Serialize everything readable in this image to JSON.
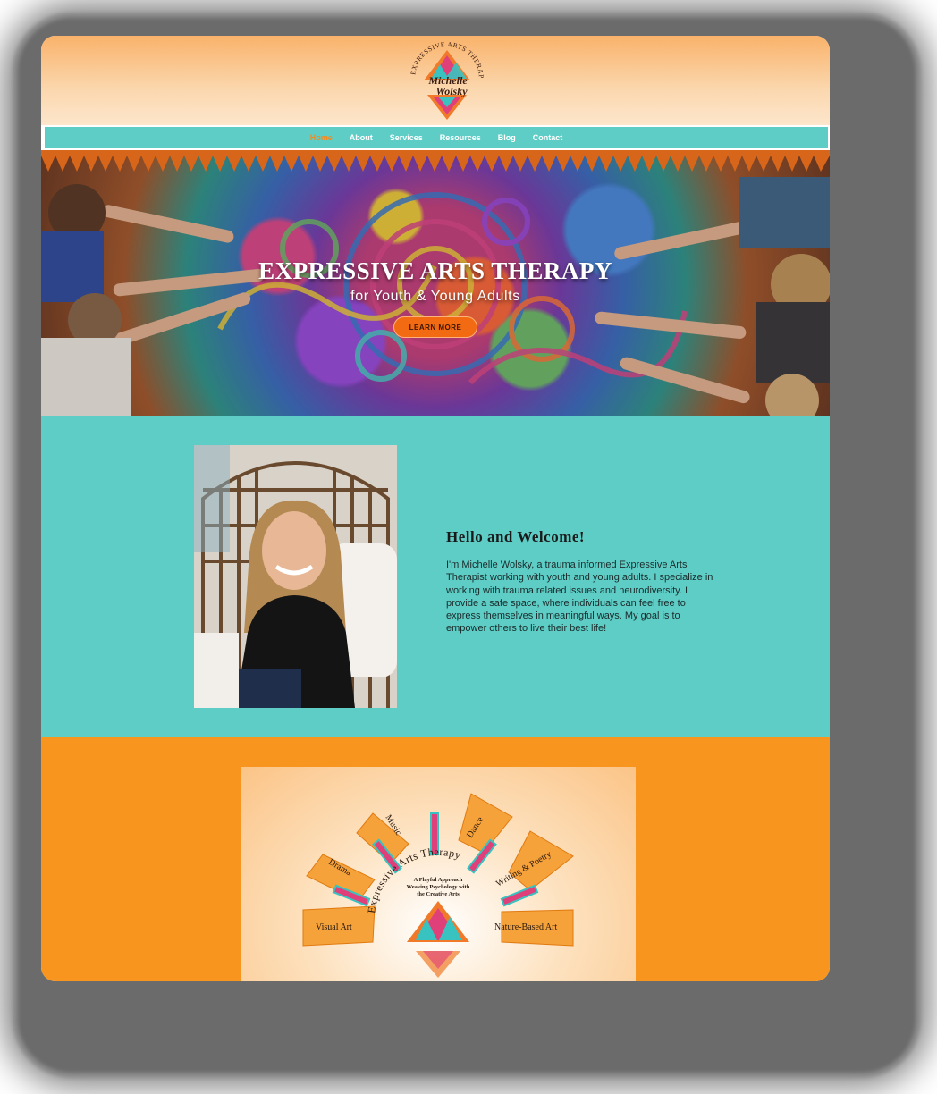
{
  "logo": {
    "arc_text": "EXPRESSIVE ARTS THERAPY",
    "name_line1": "Michelle",
    "name_line2": "Wolsky"
  },
  "nav": {
    "items": [
      {
        "label": "Home",
        "active": true
      },
      {
        "label": "About",
        "active": false
      },
      {
        "label": "Services",
        "active": false
      },
      {
        "label": "Resources",
        "active": false
      },
      {
        "label": "Blog",
        "active": false
      },
      {
        "label": "Contact",
        "active": false
      }
    ]
  },
  "hero": {
    "title": "EXPRESSIVE ARTS THERAPY",
    "subtitle": "for Youth & Young Adults",
    "button_label": "LEARN MORE"
  },
  "welcome": {
    "heading": "Hello and Welcome!",
    "body": "I'm Michelle Wolsky, a trauma informed Expressive Arts Therapist working with youth and young adults. I specialize in working with trauma related issues and neurodiversity. I provide a safe space, where individuals can feel free to express themselves in meaningful ways. My goal is to empower others to live their best life!"
  },
  "modalities": {
    "arc_title": "Expressive Arts Therapy",
    "tagline_line1": "A Playful Approach",
    "tagline_line2": "Weaving Psychology with",
    "tagline_line3": "the Creative Arts",
    "rays": [
      "Visual Art",
      "Drama",
      "Music",
      "Dance",
      "Writing & Poetry",
      "Nature-Based Art"
    ]
  },
  "colors": {
    "teal": "#5ecdc6",
    "orange": "#f7951f",
    "nav_active": "#f58a1f",
    "button": "#f26a12",
    "pink": "#e0407a"
  }
}
